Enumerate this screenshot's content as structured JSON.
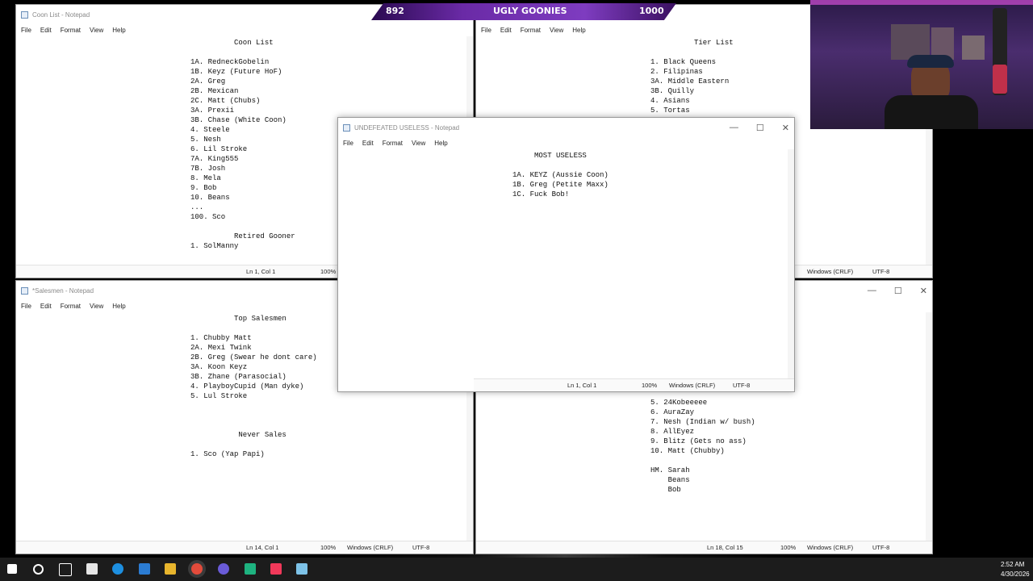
{
  "overlay": {
    "left_count": "892",
    "title": "UGLY GOONIES",
    "right_count": "1000"
  },
  "menu": [
    "File",
    "Edit",
    "Format",
    "View",
    "Help"
  ],
  "windows": {
    "coon_list": {
      "title": "Coon List - Notepad",
      "lines": [
        "          Coon List",
        "",
        "1A. RedneckGobelin",
        "1B. Keyz (Future HoF)",
        "2A. Greg",
        "2B. Mexican",
        "2C. Matt (Chubs)",
        "3A. Prexii",
        "3B. Chase (White Coon)",
        "4. Steele",
        "5. Nesh",
        "6. Lil Stroke",
        "7A. King555",
        "7B. Josh",
        "8. Mela",
        "9. Bob",
        "10. Beans",
        "...",
        "100. Sco",
        "",
        "          Retired Gooner",
        "1. SolManny"
      ],
      "status_pos": "Ln 1, Col 1",
      "zoom": "100%"
    },
    "tier_list": {
      "title": "",
      "lines": [
        "          Tier List",
        "",
        "1. Black Queens",
        "2. Filipinas",
        "3A. Middle Eastern",
        "3B. Quilly",
        "4. Asians",
        "5. Tortas"
      ],
      "line_ending": "Windows (CRLF)",
      "encoding": "UTF-8"
    },
    "undefeated": {
      "title": "UNDEFEATED USELESS - Notepad",
      "lines": [
        "     MOST USELESS",
        "",
        "1A. KEYZ (Aussie Coon)",
        "1B. Greg (Petite Maxx)",
        "1C. Fuck Bob!"
      ],
      "status_pos": "Ln 1, Col 1",
      "zoom": "100%",
      "line_ending": "Windows (CRLF)",
      "encoding": "UTF-8"
    },
    "salesmen": {
      "title": "*Salesmen - Notepad",
      "lines": [
        "          Top Salesmen",
        "",
        "1. Chubby Matt",
        "2A. Mexi Twink",
        "2B. Greg (Swear he dont care)",
        "3A. Koon Keyz",
        "3B. Zhane (Parasocial)",
        "4. PlayboyCupid (Man dyke)",
        "5. Lul Stroke",
        "",
        "",
        "",
        "           Never Sales",
        "",
        "1. Sco (Yap Papi)"
      ],
      "status_pos": "Ln 14, Col 1",
      "zoom": "100%",
      "line_ending": "Windows (CRLF)",
      "encoding": "UTF-8"
    },
    "bottom_right": {
      "title": "",
      "lines": [
        "5. 24Kobeeeee",
        "6. AuraZay",
        "7. Nesh (Indian w/ bush)",
        "8. AllEyez",
        "9. Blitz (Gets no ass)",
        "10. Matt (Chubby)",
        "",
        "HM. Sarah",
        "    Beans",
        "    Bob"
      ],
      "status_pos": "Ln 18, Col 15",
      "zoom": "100%",
      "line_ending": "Windows (CRLF)",
      "encoding": "UTF-8"
    }
  },
  "taskbar": {
    "time": "2:52 AM",
    "date": "4/30/2026"
  }
}
